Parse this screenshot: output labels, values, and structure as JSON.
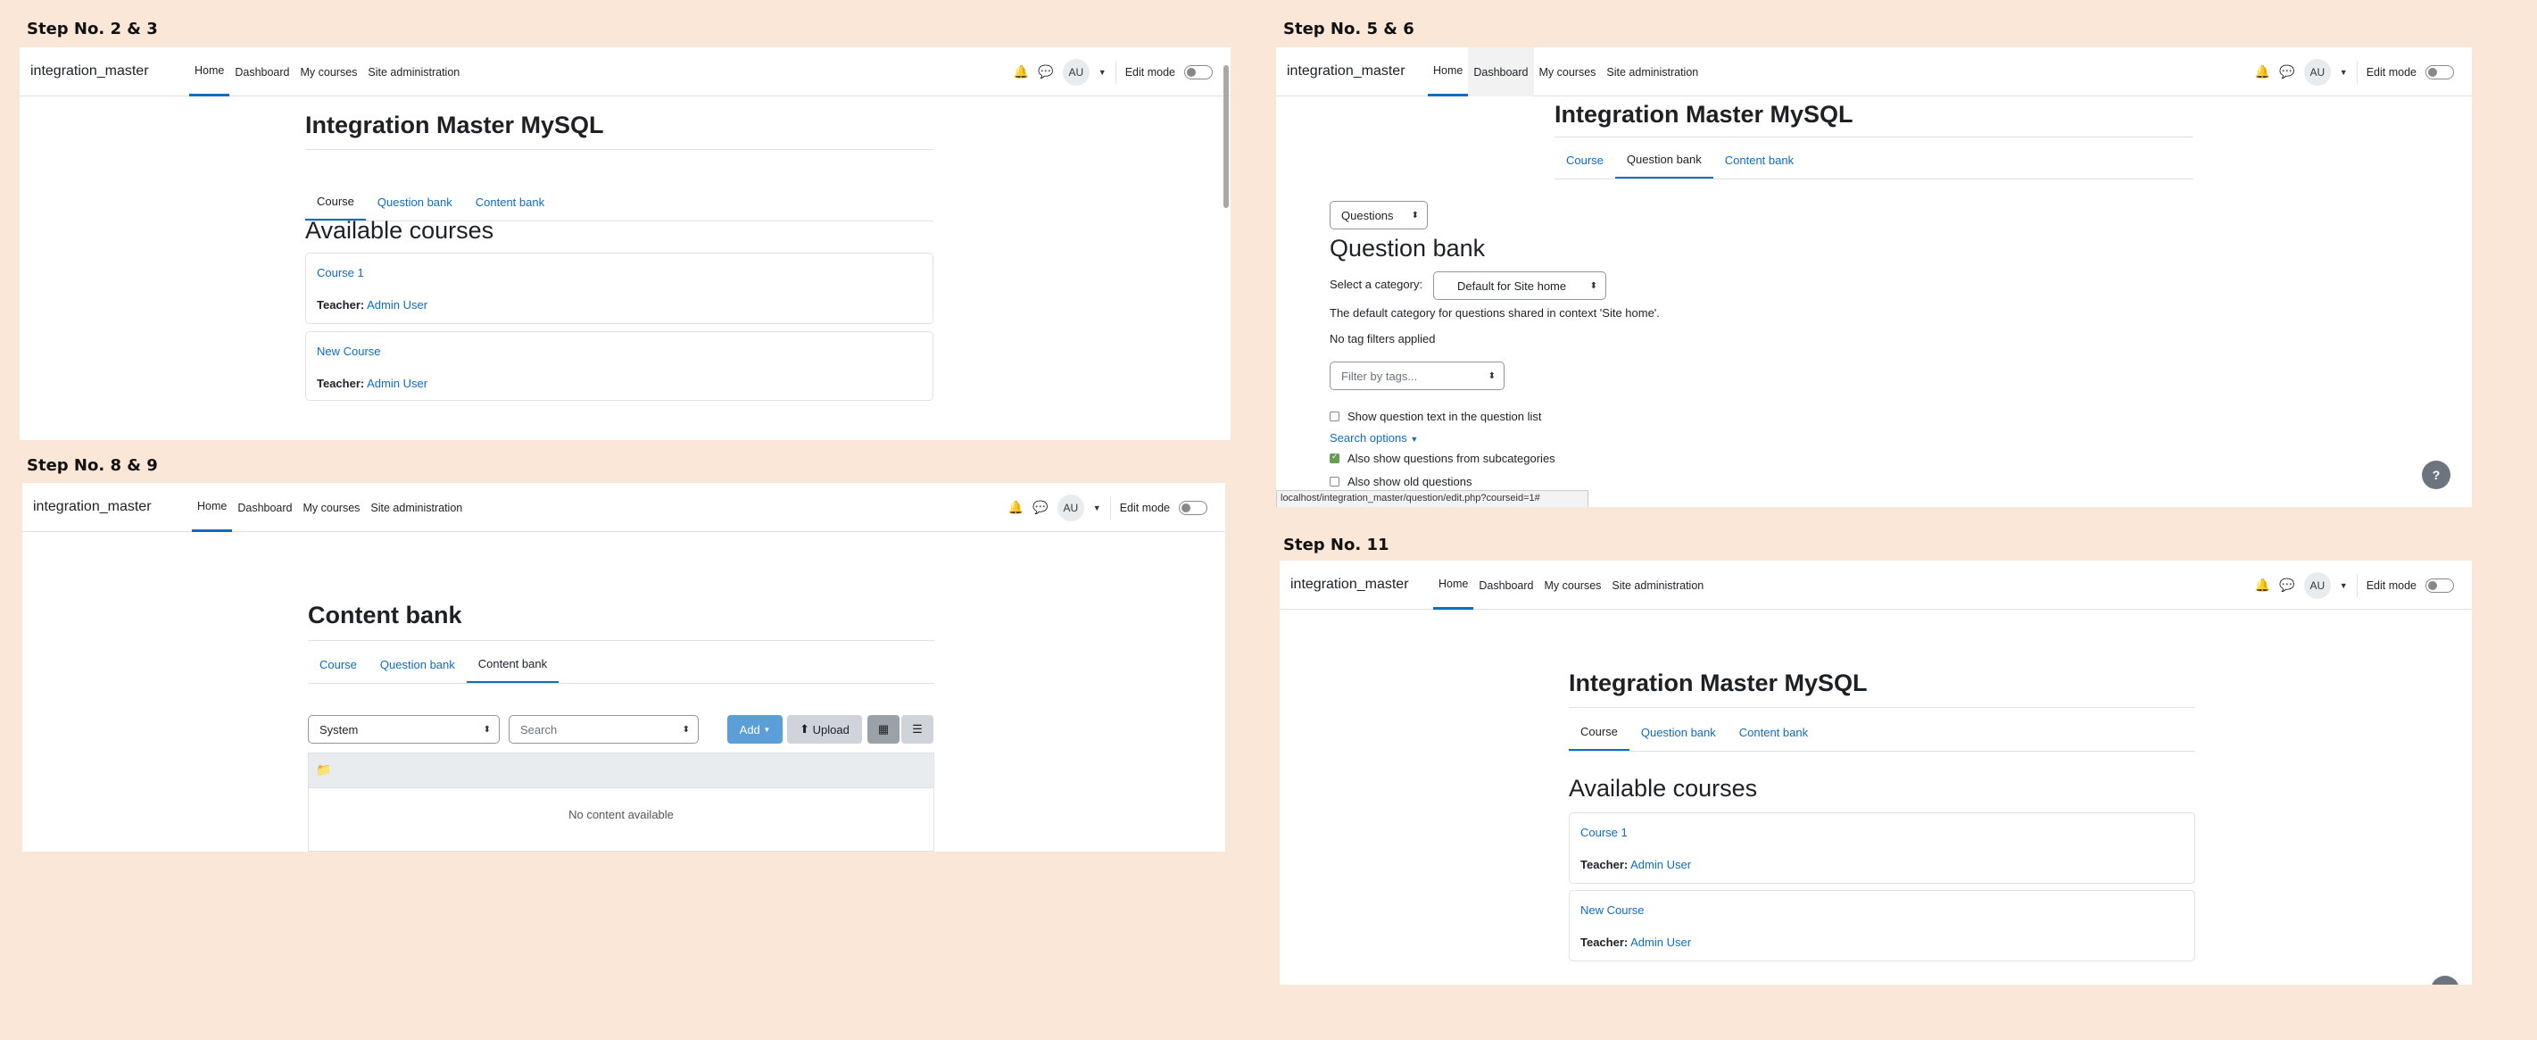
{
  "steps": {
    "s1": "Step No. 2 & 3",
    "s2": "Step No. 5 & 6",
    "s3": "Step No. 8 & 9",
    "s4": "Step No. 11"
  },
  "nav": {
    "brand": "integration_master",
    "home": "Home",
    "dashboard": "Dashboard",
    "my_courses": "My courses",
    "site_admin": "Site administration",
    "avatar": "AU",
    "edit_mode": "Edit mode"
  },
  "site_title": "Integration Master MySQL",
  "tabs": {
    "course": "Course",
    "question_bank": "Question bank",
    "content_bank": "Content bank"
  },
  "courses": {
    "heading": "Available courses",
    "teacher_label": "Teacher:",
    "teacher_name": "Admin User",
    "c1": "Course 1",
    "c2": "New Course"
  },
  "question_bank": {
    "nav_select": "Questions",
    "heading": "Question bank",
    "category_label": "Select a category:",
    "category_value": "Default for Site home",
    "category_desc": "The default category for questions shared in context 'Site home'.",
    "no_tag": "No tag filters applied",
    "filter_placeholder": "Filter by tags...",
    "show_text": "Show question text in the question list",
    "search_options": "Search options",
    "subcats": "Also show questions from subcategories",
    "old": "Also show old questions",
    "status_url": "localhost/integration_master/question/edit.php?courseid=1#",
    "help": "?"
  },
  "content_bank": {
    "heading": "Content bank",
    "context_select": "System",
    "search_placeholder": "Search",
    "add": "Add",
    "upload": "Upload",
    "empty": "No content available"
  }
}
